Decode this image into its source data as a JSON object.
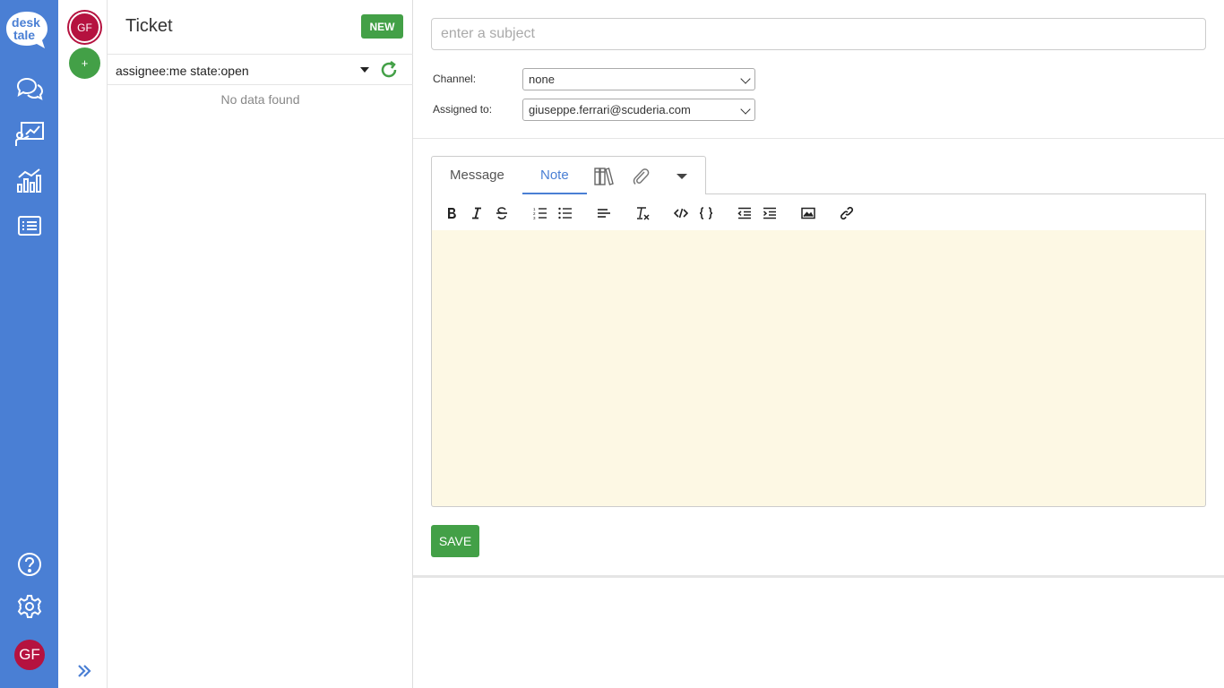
{
  "brand": {
    "logo_line1": "desk",
    "logo_line2": "tale",
    "accent": "#4a7fd4",
    "success": "#43a047",
    "avatar": "#b5123f"
  },
  "nav": {
    "items": [
      {
        "icon": "chat-bubbles-icon"
      },
      {
        "icon": "presentation-chart-icon"
      },
      {
        "icon": "analytics-chart-icon"
      },
      {
        "icon": "list-icon"
      }
    ],
    "help_icon": "help-circle-icon",
    "settings_icon": "gear-icon",
    "user_initials": "GF"
  },
  "secondary": {
    "user_initials": "GF",
    "add_label": "+",
    "expand_icon": "double-chevron-right-icon"
  },
  "ticket_list": {
    "title": "Ticket",
    "new_label": "NEW",
    "filter": "assignee:me state:open",
    "empty": "No data found"
  },
  "form": {
    "subject_placeholder": "enter a subject",
    "channel_label": "Channel:",
    "channel_value": "none",
    "assigned_label": "Assigned to:",
    "assigned_value": "giuseppe.ferrari@scuderia.com"
  },
  "editor": {
    "tabs": [
      {
        "label": "Message"
      },
      {
        "label": "Note"
      }
    ],
    "active_tab": "Note",
    "save_label": "SAVE"
  }
}
